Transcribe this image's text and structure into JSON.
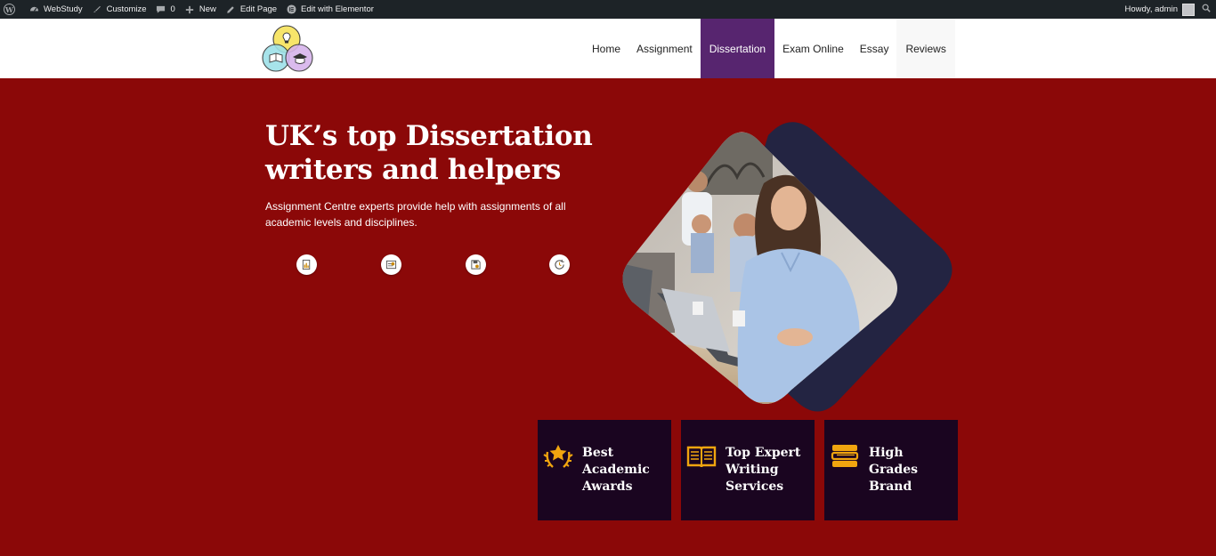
{
  "admin_bar": {
    "site_name": "WebStudy",
    "customize": "Customize",
    "comments_count": "0",
    "new": "New",
    "edit_page": "Edit Page",
    "edit_elementor": "Edit with Elementor",
    "howdy": "Howdy, admin"
  },
  "nav": {
    "items": [
      "Home",
      "Assignment",
      "Dissertation",
      "Exam Online",
      "Essay",
      "Reviews"
    ],
    "active": "Dissertation"
  },
  "hero": {
    "title": "UK’s top Dissertation writers and helpers",
    "subtitle": "Assignment Centre experts provide help with assignments of all academic levels and disciplines."
  },
  "cards": [
    {
      "label": "Best Academic Awards",
      "icon": "award-laurel-icon"
    },
    {
      "label": "Top Expert Writing Services",
      "icon": "open-book-icon"
    },
    {
      "label": "High Grades Brand",
      "icon": "book-stack-icon"
    }
  ],
  "colors": {
    "hero_bg": "#8b0808",
    "nav_active_bg": "#57256f",
    "card_bg": "#1a0520",
    "card_icon": "#f0a50f",
    "admin_bar_bg": "#1d2327"
  }
}
